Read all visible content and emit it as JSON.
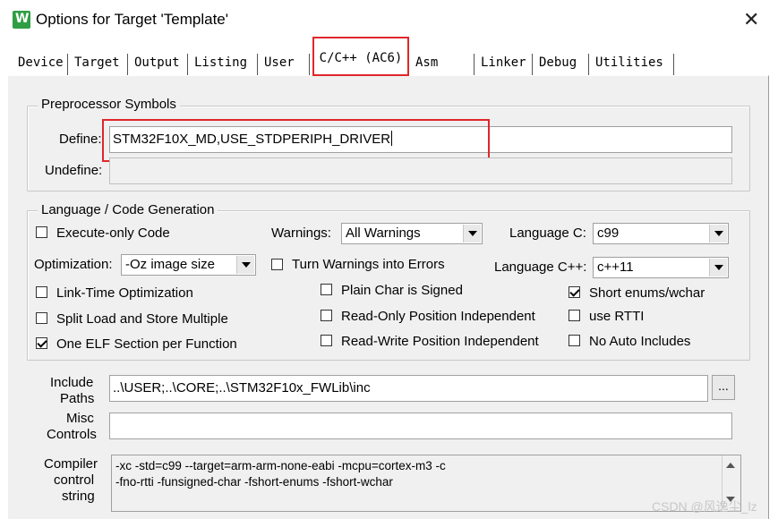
{
  "window": {
    "title": "Options for Target 'Template'",
    "close_glyph": "✕",
    "icon_glyph": "W"
  },
  "tabs": [
    "Device",
    "Target",
    "Output",
    "Listing",
    "User",
    "C/C++ (AC6)",
    "Asm",
    "Linker",
    "Debug",
    "Utilities"
  ],
  "preprocessor": {
    "group_title": "Preprocessor Symbols",
    "define_label": "Define:",
    "define_value": "STM32F10X_MD,USE_STDPERIPH_DRIVER",
    "undefine_label": "Undefine:",
    "undefine_value": ""
  },
  "language": {
    "group_title": "Language / Code Generation",
    "execute_only": {
      "label": "Execute-only Code",
      "checked": false
    },
    "optimization_label": "Optimization:",
    "optimization_value": "-Oz image size",
    "link_time": {
      "label": "Link-Time Optimization",
      "checked": false
    },
    "split_load": {
      "label": "Split Load and Store Multiple",
      "checked": false
    },
    "one_elf": {
      "label": "One ELF Section per Function",
      "checked": true
    },
    "warnings_label": "Warnings:",
    "warnings_value": "All Warnings",
    "turn_warnings": {
      "label": "Turn Warnings into Errors",
      "checked": false
    },
    "plain_char": {
      "label": "Plain Char is Signed",
      "checked": false
    },
    "ro_pi": {
      "label": "Read-Only Position Independent",
      "checked": false
    },
    "rw_pi": {
      "label": "Read-Write Position Independent",
      "checked": false
    },
    "language_c_label": "Language C:",
    "language_c_value": "c99",
    "language_cpp_label": "Language C++:",
    "language_cpp_value": "c++11",
    "short_enums": {
      "label": "Short enums/wchar",
      "checked": true
    },
    "use_rtti": {
      "label": "use RTTI",
      "checked": false
    },
    "no_auto_includes": {
      "label": "No Auto Includes",
      "checked": false
    }
  },
  "include_paths": {
    "label_line1": "Include",
    "label_line2": "Paths",
    "value": "..\\USER;..\\CORE;..\\STM32F10x_FWLib\\inc",
    "browse_label": "..."
  },
  "misc_controls": {
    "label_line1": "Misc",
    "label_line2": "Controls",
    "value": ""
  },
  "compiler_string": {
    "label_line1": "Compiler",
    "label_line2": "control",
    "label_line3": "string",
    "line1": "-xc -std=c99 --target=arm-arm-none-eabi -mcpu=cortex-m3 -c",
    "line2": "-fno-rtti -funsigned-char -fshort-enums -fshort-wchar"
  },
  "watermark": "CSDN @风逸尘_lz",
  "colors": {
    "highlight_red": "#e0262a",
    "dialog_bg": "#f0f0f0"
  }
}
